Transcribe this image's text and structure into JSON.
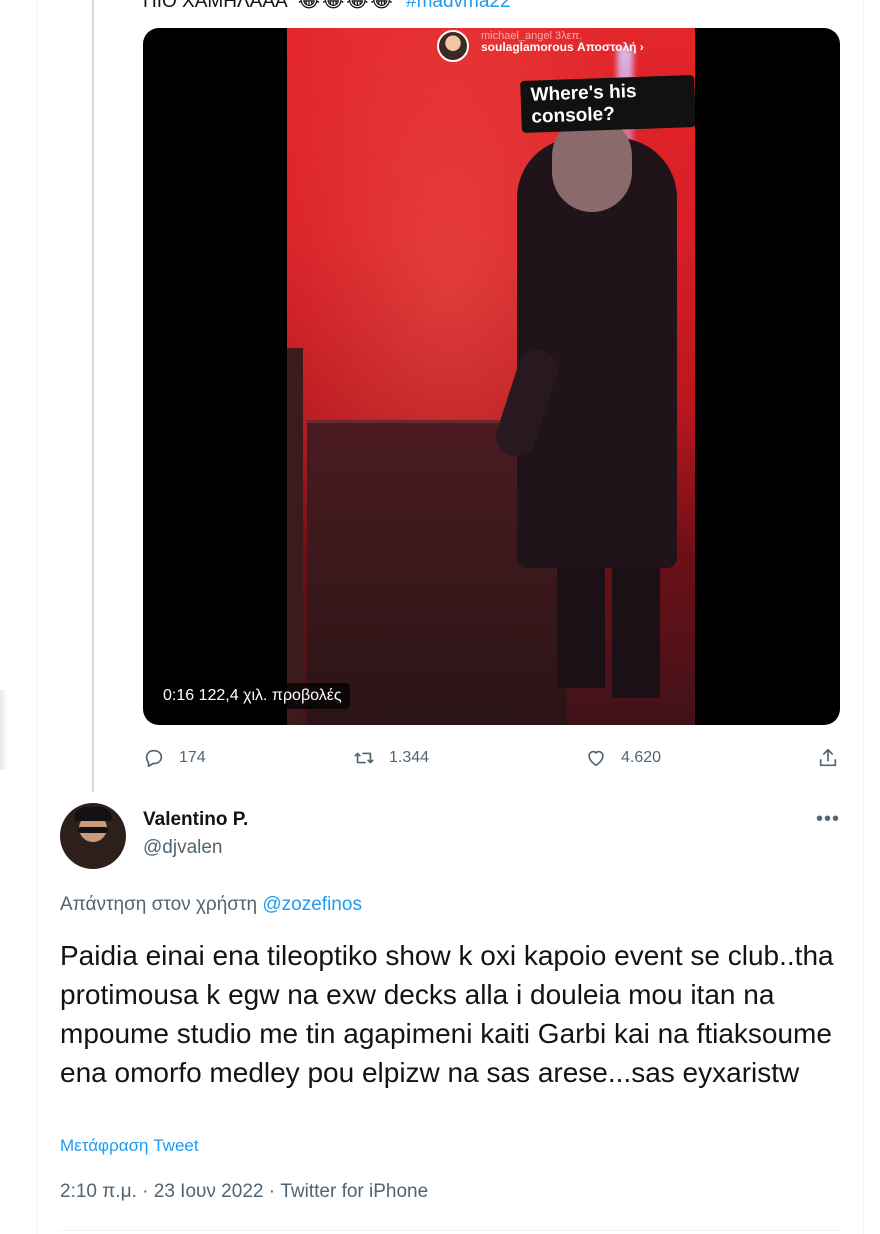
{
  "previous_tweet": {
    "text_start": "ΠΙΟ ΧΑΜΗΛΑΑΑ",
    "emojis": "😂😂😂😂",
    "hashtag": "#madvma22"
  },
  "video": {
    "story_user_top": "michael_angel",
    "story_user_time": "3λεπ.",
    "story_user_main": "soulaglamorous",
    "story_user_suffix": "Αποστολή",
    "story_menu": "•••",
    "story_close": "✕",
    "caption": "Where's his console?",
    "caption_emoji": "😂",
    "time_label": "0:16   122,4 χιλ. προβολές"
  },
  "actions": {
    "replies": "174",
    "retweets": "1.344",
    "likes": "4.620"
  },
  "reply_tweet": {
    "display_name": "Valentino P.",
    "handle": "@djvalen",
    "more": "•••",
    "reply_to_prefix": "Απάντηση στον χρήστη",
    "reply_to_mention": "@zozefinos",
    "body": "Paidia einai ena tileoptiko show k oxi kapoio event se club..tha protimousa k egw na exw decks alla i douleia mou itan na mpoume studio me tin agapimeni kaiti Garbi kai na ftiaksoume ena omorfo medley pou elpizw na sas arese...sas eyxaristw",
    "translate": "Μετάφραση Tweet",
    "meta": "2:10 π.μ. · 23 Ιουν 2022 · Twitter for iPhone"
  },
  "colors": {
    "accent": "#1d9bf0",
    "secondary_text": "#536471",
    "primary_text": "#0f1419"
  }
}
